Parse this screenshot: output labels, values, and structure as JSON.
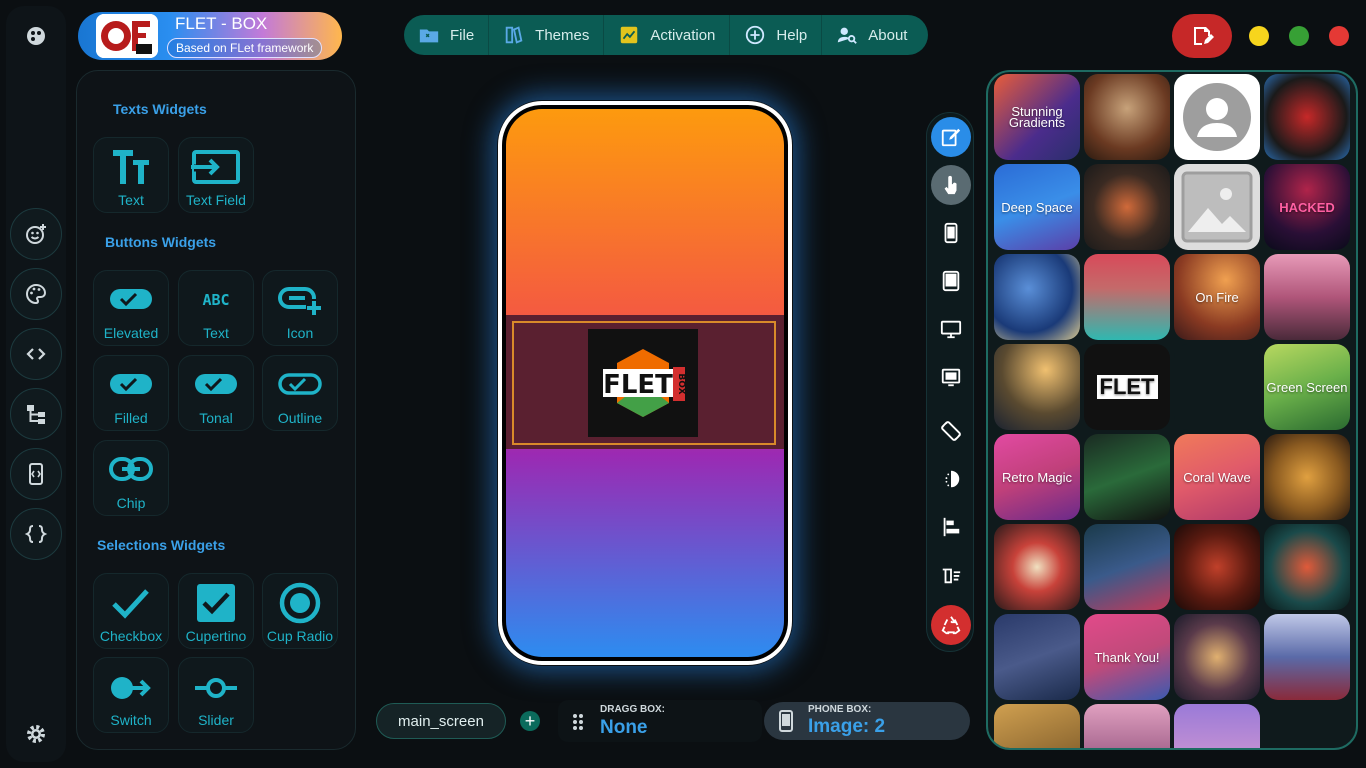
{
  "app": {
    "title": "FLET - BOX",
    "subtitle": "Based on FLet framework",
    "logo_text": "FLET"
  },
  "menu": [
    {
      "label": "File",
      "icon": "file-icon"
    },
    {
      "label": "Themes",
      "icon": "themes-icon"
    },
    {
      "label": "Activation",
      "icon": "activation-icon"
    },
    {
      "label": "Help",
      "icon": "help-icon"
    },
    {
      "label": "About",
      "icon": "about-icon"
    }
  ],
  "window_controls": {
    "colors": [
      "#f7d51d",
      "#37a035",
      "#e53935"
    ]
  },
  "widgets": {
    "texts_title": "Texts Widgets",
    "texts": [
      "Text",
      "Text Field"
    ],
    "buttons_title": "Buttons Widgets",
    "buttons": [
      "Elevated",
      "Text",
      "Icon",
      "Filled",
      "Tonal",
      "Outline",
      "Chip"
    ],
    "selections_title": "Selections Widgets",
    "selections": [
      "Checkbox",
      "Cupertino",
      "Cup Radio",
      "Switch",
      "Slider"
    ]
  },
  "phone": {
    "image_text": "FLET",
    "image_side_text": "BOX"
  },
  "bottom": {
    "screen_name": "main_screen",
    "add_label": "+",
    "drag_label": "DRAGG BOX:",
    "drag_value": "None",
    "phone_label": "PHONE BOX:",
    "phone_value": "Image: 2"
  },
  "gallery": [
    {
      "text": "Stunning Gradients"
    },
    {
      "text": ""
    },
    {
      "text": ""
    },
    {
      "text": ""
    },
    {
      "text": "Deep Space"
    },
    {
      "text": ""
    },
    {
      "text": ""
    },
    {
      "text": "HACKED"
    },
    {
      "text": ""
    },
    {
      "text": ""
    },
    {
      "text": "On Fire"
    },
    {
      "text": ""
    },
    {
      "text": ""
    },
    {
      "text": "FLET"
    },
    {
      "text": ""
    },
    {
      "text": "Green Screen"
    },
    {
      "text": "Retro Magic"
    },
    {
      "text": ""
    },
    {
      "text": "Coral Wave"
    },
    {
      "text": ""
    },
    {
      "text": ""
    },
    {
      "text": ""
    },
    {
      "text": ""
    },
    {
      "text": ""
    },
    {
      "text": ""
    },
    {
      "text": "Thank You!"
    },
    {
      "text": ""
    },
    {
      "text": ""
    }
  ],
  "colors": {
    "accent": "#1fb3c8",
    "title": "#3aa0e8",
    "menubar": "#0b5c54",
    "danger": "#c62828"
  }
}
